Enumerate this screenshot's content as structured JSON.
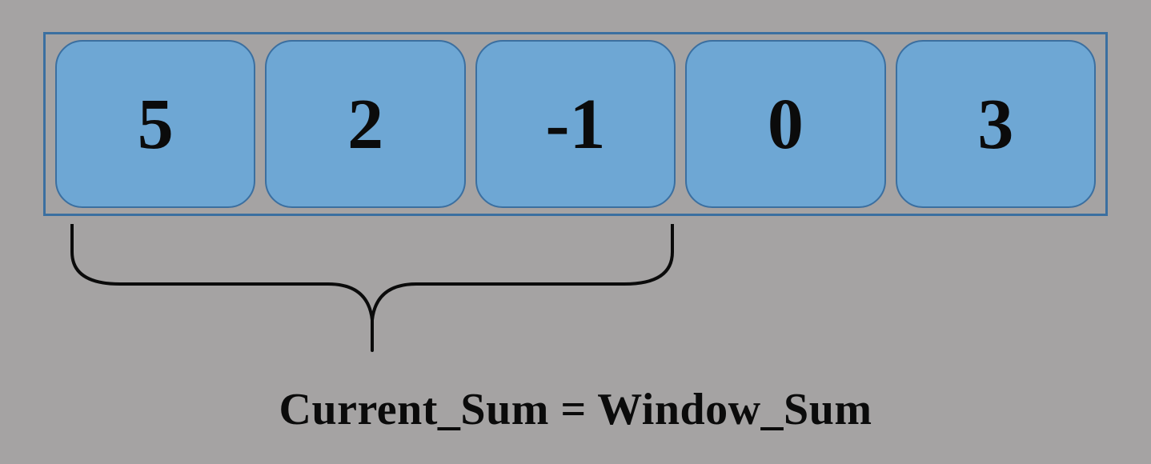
{
  "array": {
    "cells": [
      "5",
      "2",
      "-1",
      "0",
      "3"
    ]
  },
  "window": {
    "start_index": 0,
    "end_index": 2
  },
  "caption": "Current_Sum = Window_Sum",
  "colors": {
    "background": "#a5a3a3",
    "cell_fill": "#6ea7d4",
    "cell_border": "#3b6fa0",
    "text": "#0b0b0b"
  }
}
